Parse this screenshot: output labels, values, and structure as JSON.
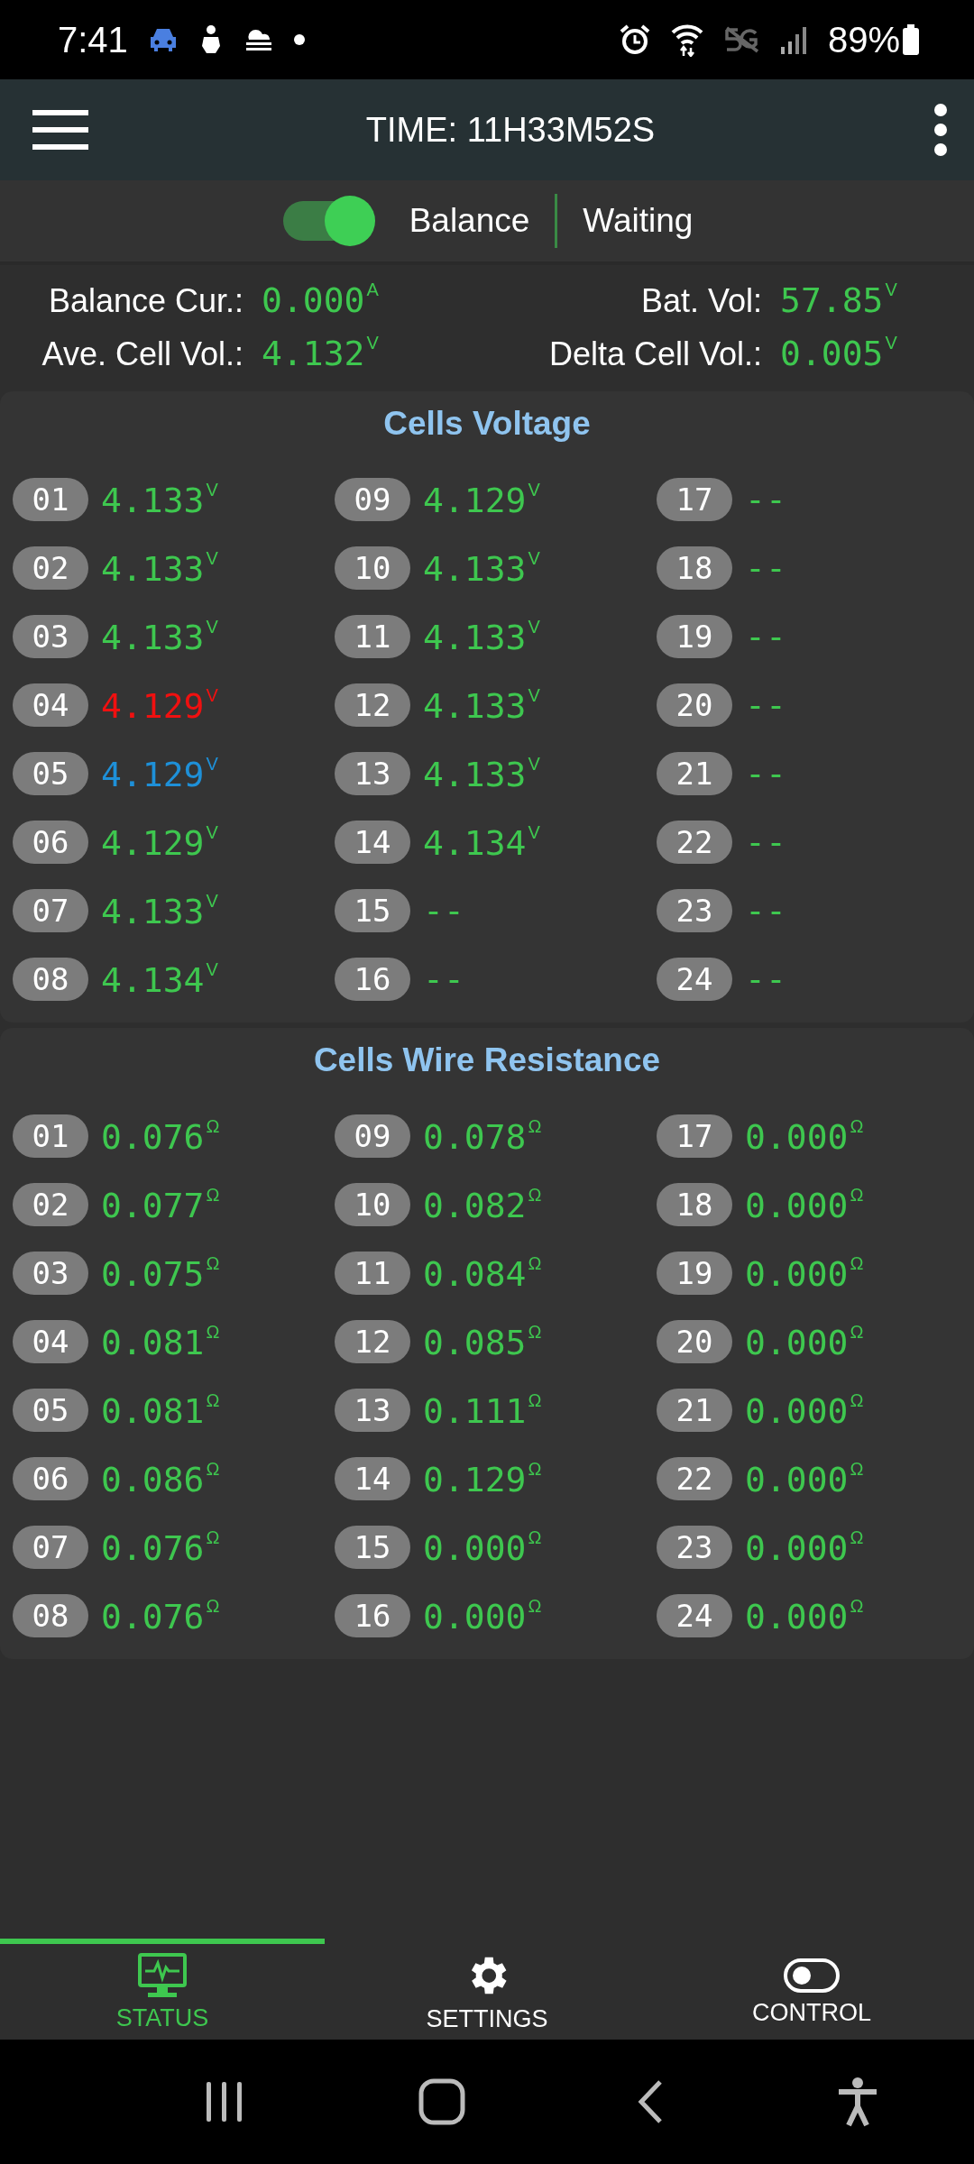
{
  "status_bar": {
    "time": "7:41",
    "battery": "89%"
  },
  "app_bar": {
    "title": "TIME: 11H33M52S"
  },
  "balance": {
    "on": true,
    "label": "Balance",
    "status": "Waiting"
  },
  "stats": [
    {
      "label": "Balance Cur.:",
      "value": "0.000",
      "unit": "A"
    },
    {
      "label": "Bat. Vol:",
      "value": "57.85",
      "unit": "V"
    },
    {
      "label": "Ave. Cell Vol.:",
      "value": "4.132",
      "unit": "V"
    },
    {
      "label": "Delta Cell Vol.:",
      "value": "0.005",
      "unit": "V"
    }
  ],
  "sections": [
    {
      "title": "Cells Voltage",
      "cells": [
        {
          "index": "01",
          "value": "4.133",
          "unit": "V",
          "color": "#3ec74f"
        },
        {
          "index": "02",
          "value": "4.133",
          "unit": "V",
          "color": "#3ec74f"
        },
        {
          "index": "03",
          "value": "4.133",
          "unit": "V",
          "color": "#3ec74f"
        },
        {
          "index": "04",
          "value": "4.129",
          "unit": "V",
          "color": "#f01010"
        },
        {
          "index": "05",
          "value": "4.129",
          "unit": "V",
          "color": "#1e90d8"
        },
        {
          "index": "06",
          "value": "4.129",
          "unit": "V",
          "color": "#3ec74f"
        },
        {
          "index": "07",
          "value": "4.133",
          "unit": "V",
          "color": "#3ec74f"
        },
        {
          "index": "08",
          "value": "4.134",
          "unit": "V",
          "color": "#3ec74f"
        },
        {
          "index": "09",
          "value": "4.129",
          "unit": "V",
          "color": "#3ec74f"
        },
        {
          "index": "10",
          "value": "4.133",
          "unit": "V",
          "color": "#3ec74f"
        },
        {
          "index": "11",
          "value": "4.133",
          "unit": "V",
          "color": "#3ec74f"
        },
        {
          "index": "12",
          "value": "4.133",
          "unit": "V",
          "color": "#3ec74f"
        },
        {
          "index": "13",
          "value": "4.133",
          "unit": "V",
          "color": "#3ec74f"
        },
        {
          "index": "14",
          "value": "4.134",
          "unit": "V",
          "color": "#3ec74f"
        },
        {
          "index": "15",
          "value": "--",
          "color": "#3ec74f"
        },
        {
          "index": "16",
          "value": "--",
          "color": "#3ec74f"
        },
        {
          "index": "17",
          "value": "--",
          "color": "#3ec74f"
        },
        {
          "index": "18",
          "value": "--",
          "color": "#3ec74f"
        },
        {
          "index": "19",
          "value": "--",
          "color": "#3ec74f"
        },
        {
          "index": "20",
          "value": "--",
          "color": "#3ec74f"
        },
        {
          "index": "21",
          "value": "--",
          "color": "#3ec74f"
        },
        {
          "index": "22",
          "value": "--",
          "color": "#3ec74f"
        },
        {
          "index": "23",
          "value": "--",
          "color": "#3ec74f"
        },
        {
          "index": "24",
          "value": "--",
          "color": "#3ec74f"
        }
      ]
    },
    {
      "title": "Cells Wire Resistance",
      "cells": [
        {
          "index": "01",
          "value": "0.076",
          "unit": "Ω",
          "color": "#3ec74f"
        },
        {
          "index": "02",
          "value": "0.077",
          "unit": "Ω",
          "color": "#3ec74f"
        },
        {
          "index": "03",
          "value": "0.075",
          "unit": "Ω",
          "color": "#3ec74f"
        },
        {
          "index": "04",
          "value": "0.081",
          "unit": "Ω",
          "color": "#3ec74f"
        },
        {
          "index": "05",
          "value": "0.081",
          "unit": "Ω",
          "color": "#3ec74f"
        },
        {
          "index": "06",
          "value": "0.086",
          "unit": "Ω",
          "color": "#3ec74f"
        },
        {
          "index": "07",
          "value": "0.076",
          "unit": "Ω",
          "color": "#3ec74f"
        },
        {
          "index": "08",
          "value": "0.076",
          "unit": "Ω",
          "color": "#3ec74f"
        },
        {
          "index": "09",
          "value": "0.078",
          "unit": "Ω",
          "color": "#3ec74f"
        },
        {
          "index": "10",
          "value": "0.082",
          "unit": "Ω",
          "color": "#3ec74f"
        },
        {
          "index": "11",
          "value": "0.084",
          "unit": "Ω",
          "color": "#3ec74f"
        },
        {
          "index": "12",
          "value": "0.085",
          "unit": "Ω",
          "color": "#3ec74f"
        },
        {
          "index": "13",
          "value": "0.111",
          "unit": "Ω",
          "color": "#3ec74f"
        },
        {
          "index": "14",
          "value": "0.129",
          "unit": "Ω",
          "color": "#3ec74f"
        },
        {
          "index": "15",
          "value": "0.000",
          "unit": "Ω",
          "color": "#3ec74f"
        },
        {
          "index": "16",
          "value": "0.000",
          "unit": "Ω",
          "color": "#3ec74f"
        },
        {
          "index": "17",
          "value": "0.000",
          "unit": "Ω",
          "color": "#3ec74f"
        },
        {
          "index": "18",
          "value": "0.000",
          "unit": "Ω",
          "color": "#3ec74f"
        },
        {
          "index": "19",
          "value": "0.000",
          "unit": "Ω",
          "color": "#3ec74f"
        },
        {
          "index": "20",
          "value": "0.000",
          "unit": "Ω",
          "color": "#3ec74f"
        },
        {
          "index": "21",
          "value": "0.000",
          "unit": "Ω",
          "color": "#3ec74f"
        },
        {
          "index": "22",
          "value": "0.000",
          "unit": "Ω",
          "color": "#3ec74f"
        },
        {
          "index": "23",
          "value": "0.000",
          "unit": "Ω",
          "color": "#3ec74f"
        },
        {
          "index": "24",
          "value": "0.000",
          "unit": "Ω",
          "color": "#3ec74f"
        }
      ]
    }
  ],
  "bottom_nav": [
    {
      "label": "STATUS",
      "selected": true
    },
    {
      "label": "SETTINGS",
      "selected": false
    },
    {
      "label": "CONTROL",
      "selected": false
    }
  ]
}
